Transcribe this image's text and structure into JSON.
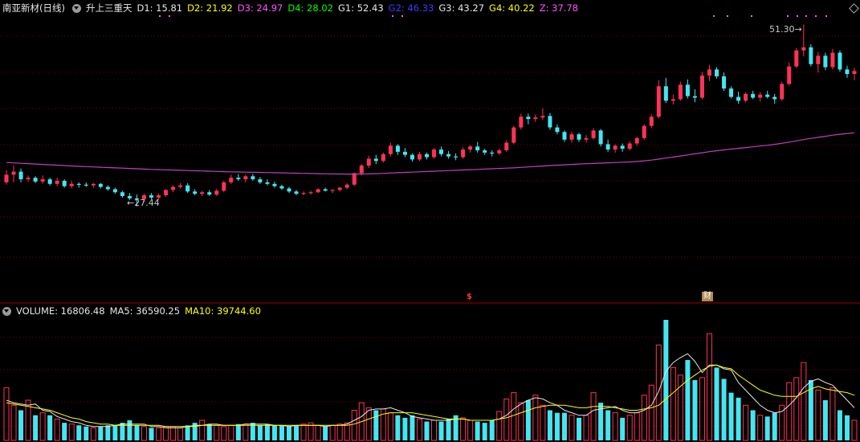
{
  "main_header": {
    "title": "南亚新材(日线)",
    "indicator": "升上三重天",
    "values": [
      {
        "label": "D1: 15.81",
        "color": "#e6e6e6"
      },
      {
        "label": "D2: 21.92",
        "color": "#ffff00"
      },
      {
        "label": "D3: 24.97",
        "color": "#ff55ff"
      },
      {
        "label": "D4: 28.02",
        "color": "#00ff00"
      },
      {
        "label": "G1: 52.43",
        "color": "#e6e6e6"
      },
      {
        "label": "G2: 46.33",
        "color": "#3b3bff"
      },
      {
        "label": "G3: 43.27",
        "color": "#e6e6e6"
      },
      {
        "label": "G4: 40.22",
        "color": "#ffff00"
      },
      {
        "label": "Z: 37.78",
        "color": "#ff55ff"
      }
    ]
  },
  "volume_header": {
    "values": [
      {
        "label": "VOLUME: 16806.48",
        "color": "#e6e6e6"
      },
      {
        "label": "MA5: 36590.25",
        "color": "#e6e6e6"
      },
      {
        "label": "MA10: 39744.60",
        "color": "#ffff00"
      }
    ]
  },
  "annotations": {
    "low_label": "27.44",
    "high_label": "51.30"
  },
  "markers": {
    "s": "$",
    "fin": "财"
  },
  "colors": {
    "up": "#ff3355",
    "down": "#44e6f0",
    "ma": "#c040c0",
    "grid": "#7a0000",
    "divider": "#a00000",
    "vol_up_border": "#ff3355",
    "vol_down": "#44e6f0"
  },
  "chart_data": [
    {
      "type": "candlestick",
      "title": "南亚新材(日线)",
      "annotations": {
        "low": 27.44,
        "high": 51.3
      },
      "ohlc": [
        [
          30.6,
          32.2,
          30.3,
          31.6
        ],
        [
          31.6,
          32.8,
          30.6,
          32.0
        ],
        [
          32.0,
          32.4,
          30.6,
          31.0
        ],
        [
          31.0,
          31.5,
          30.7,
          31.2
        ],
        [
          31.2,
          31.4,
          30.5,
          30.7
        ],
        [
          30.7,
          31.5,
          30.4,
          31.0
        ],
        [
          31.0,
          31.2,
          30.2,
          30.4
        ],
        [
          30.4,
          31.2,
          30.1,
          30.8
        ],
        [
          30.8,
          31.0,
          29.9,
          30.1
        ],
        [
          30.1,
          30.8,
          29.8,
          30.4
        ],
        [
          30.4,
          30.6,
          29.9,
          30.3
        ],
        [
          30.3,
          30.6,
          30.0,
          30.2
        ],
        [
          30.2,
          30.5,
          29.9,
          30.4
        ],
        [
          30.4,
          30.5,
          29.8,
          30.0
        ],
        [
          30.0,
          30.2,
          29.5,
          29.7
        ],
        [
          29.7,
          29.9,
          29.1,
          29.3
        ],
        [
          29.3,
          29.5,
          28.6,
          28.8
        ],
        [
          28.8,
          29.2,
          28.3,
          28.5
        ],
        [
          28.5,
          29.0,
          27.44,
          28.4
        ],
        [
          28.4,
          29.1,
          28.0,
          28.9
        ],
        [
          28.9,
          29.2,
          28.4,
          28.6
        ],
        [
          28.6,
          29.1,
          28.3,
          28.9
        ],
        [
          28.9,
          29.7,
          28.7,
          29.6
        ],
        [
          29.6,
          30.2,
          29.3,
          30.0
        ],
        [
          30.0,
          30.5,
          29.8,
          30.2
        ],
        [
          30.2,
          30.5,
          29.2,
          29.4
        ],
        [
          29.4,
          29.7,
          28.9,
          29.1
        ],
        [
          29.1,
          29.5,
          28.8,
          29.3
        ],
        [
          29.3,
          29.6,
          28.8,
          29.0
        ],
        [
          29.0,
          29.7,
          28.8,
          29.5
        ],
        [
          29.5,
          30.8,
          29.3,
          30.6
        ],
        [
          30.6,
          31.6,
          30.4,
          31.2
        ],
        [
          31.2,
          31.7,
          30.8,
          31.0
        ],
        [
          31.0,
          31.6,
          30.6,
          31.4
        ],
        [
          31.4,
          31.7,
          30.8,
          31.0
        ],
        [
          31.0,
          31.3,
          30.4,
          30.6
        ],
        [
          30.6,
          31.0,
          30.2,
          30.4
        ],
        [
          30.4,
          30.7,
          29.9,
          30.1
        ],
        [
          30.1,
          30.3,
          29.6,
          29.8
        ],
        [
          29.8,
          30.0,
          29.2,
          29.4
        ],
        [
          29.4,
          29.6,
          28.9,
          29.1
        ],
        [
          29.1,
          29.4,
          28.9,
          29.2
        ],
        [
          29.2,
          29.5,
          29.0,
          29.3
        ],
        [
          29.3,
          29.8,
          29.2,
          29.7
        ],
        [
          29.7,
          29.9,
          29.4,
          29.5
        ],
        [
          29.5,
          29.7,
          29.2,
          29.6
        ],
        [
          29.6,
          30.0,
          29.4,
          29.9
        ],
        [
          29.9,
          30.5,
          29.7,
          30.3
        ],
        [
          30.3,
          31.9,
          30.1,
          31.8
        ],
        [
          31.8,
          33.0,
          31.5,
          32.8
        ],
        [
          32.8,
          34.1,
          32.5,
          33.7
        ],
        [
          33.7,
          34.2,
          33.0,
          33.4
        ],
        [
          33.4,
          34.5,
          33.2,
          34.3
        ],
        [
          34.3,
          35.8,
          34.0,
          35.4
        ],
        [
          35.4,
          35.6,
          34.2,
          34.6
        ],
        [
          34.6,
          35.1,
          33.9,
          34.2
        ],
        [
          34.2,
          34.4,
          33.3,
          33.6
        ],
        [
          33.6,
          34.6,
          33.4,
          34.3
        ],
        [
          34.3,
          34.5,
          33.6,
          33.9
        ],
        [
          33.9,
          35.1,
          33.7,
          34.9
        ],
        [
          34.9,
          35.3,
          34.0,
          34.3
        ],
        [
          34.3,
          34.7,
          33.7,
          34.0
        ],
        [
          34.0,
          34.4,
          33.5,
          33.9
        ],
        [
          33.9,
          35.2,
          33.7,
          34.9
        ],
        [
          34.9,
          35.5,
          34.5,
          35.3
        ],
        [
          35.3,
          35.9,
          34.5,
          34.8
        ],
        [
          34.8,
          35.0,
          34.2,
          34.5
        ],
        [
          34.5,
          34.8,
          34.0,
          34.4
        ],
        [
          34.4,
          35.0,
          34.2,
          34.8
        ],
        [
          34.8,
          36.1,
          34.6,
          35.8
        ],
        [
          35.8,
          38.0,
          35.6,
          37.8
        ],
        [
          37.8,
          39.6,
          37.5,
          39.2
        ],
        [
          39.2,
          39.6,
          38.2,
          38.9
        ],
        [
          38.9,
          39.5,
          38.5,
          39.1
        ],
        [
          39.1,
          40.3,
          38.8,
          39.3
        ],
        [
          39.3,
          39.7,
          37.5,
          37.8
        ],
        [
          37.8,
          38.2,
          36.9,
          37.2
        ],
        [
          37.2,
          37.4,
          35.9,
          36.2
        ],
        [
          36.2,
          37.2,
          35.8,
          36.9
        ],
        [
          36.9,
          37.1,
          35.9,
          36.2
        ],
        [
          36.2,
          36.8,
          35.8,
          36.4
        ],
        [
          36.4,
          37.7,
          36.2,
          37.4
        ],
        [
          37.4,
          37.6,
          35.3,
          35.6
        ],
        [
          35.6,
          36.2,
          34.6,
          34.9
        ],
        [
          34.9,
          35.6,
          34.5,
          35.4
        ],
        [
          35.4,
          35.7,
          34.6,
          35.0
        ],
        [
          35.0,
          36.0,
          34.8,
          35.7
        ],
        [
          35.7,
          36.6,
          35.4,
          36.4
        ],
        [
          36.4,
          38.2,
          36.2,
          38.0
        ],
        [
          38.0,
          39.5,
          37.7,
          39.2
        ],
        [
          39.2,
          44.0,
          39.0,
          43.2
        ],
        [
          43.2,
          44.3,
          41.0,
          41.3
        ],
        [
          41.3,
          42.1,
          40.8,
          41.5
        ],
        [
          41.5,
          43.8,
          41.3,
          43.4
        ],
        [
          43.4,
          44.1,
          41.6,
          41.9
        ],
        [
          41.9,
          42.8,
          41.1,
          41.7
        ],
        [
          41.7,
          45.1,
          41.5,
          44.6
        ],
        [
          44.6,
          46.0,
          43.9,
          45.4
        ],
        [
          45.4,
          45.7,
          44.2,
          44.5
        ],
        [
          44.5,
          45.0,
          42.6,
          42.9
        ],
        [
          42.9,
          43.2,
          41.6,
          41.8
        ],
        [
          41.8,
          42.5,
          40.9,
          41.3
        ],
        [
          41.3,
          42.4,
          41.1,
          42.2
        ],
        [
          42.2,
          42.6,
          41.5,
          41.7
        ],
        [
          41.7,
          42.4,
          41.2,
          42.1
        ],
        [
          42.1,
          42.6,
          41.6,
          41.8
        ],
        [
          41.8,
          42.2,
          40.9,
          41.5
        ],
        [
          41.5,
          43.8,
          41.3,
          43.5
        ],
        [
          43.5,
          46.3,
          43.3,
          45.8
        ],
        [
          45.8,
          48.2,
          45.6,
          47.9
        ],
        [
          47.9,
          51.3,
          47.1,
          48.3
        ],
        [
          48.3,
          48.7,
          45.8,
          46.1
        ],
        [
          46.1,
          47.7,
          45.0,
          47.2
        ],
        [
          47.2,
          47.6,
          45.3,
          45.7
        ],
        [
          45.7,
          48.1,
          45.4,
          47.6
        ],
        [
          47.6,
          47.9,
          45.1,
          45.4
        ],
        [
          45.4,
          45.9,
          44.3,
          44.8
        ],
        [
          44.8,
          45.6,
          44.0,
          45.2
        ]
      ],
      "ma": [
        33.2,
        33.15,
        33.1,
        33.05,
        33.0,
        32.95,
        32.9,
        32.85,
        32.8,
        32.75,
        32.7,
        32.66,
        32.62,
        32.58,
        32.54,
        32.5,
        32.46,
        32.42,
        32.38,
        32.34,
        32.3,
        32.27,
        32.24,
        32.21,
        32.18,
        32.15,
        32.12,
        32.09,
        32.06,
        32.03,
        32.0,
        31.98,
        31.96,
        31.94,
        31.92,
        31.9,
        31.88,
        31.86,
        31.84,
        31.82,
        31.8,
        31.78,
        31.76,
        31.74,
        31.72,
        31.7,
        31.69,
        31.68,
        31.68,
        31.69,
        31.71,
        31.74,
        31.78,
        31.82,
        31.86,
        31.9,
        31.94,
        31.98,
        32.02,
        32.06,
        32.1,
        32.14,
        32.18,
        32.22,
        32.26,
        32.3,
        32.34,
        32.38,
        32.42,
        32.46,
        32.5,
        32.56,
        32.62,
        32.68,
        32.74,
        32.8,
        32.85,
        32.9,
        32.95,
        33.0,
        33.04,
        33.08,
        33.12,
        33.16,
        33.2,
        33.24,
        33.28,
        33.34,
        33.42,
        33.52,
        33.64,
        33.78,
        33.92,
        34.06,
        34.2,
        34.34,
        34.48,
        34.62,
        34.74,
        34.86,
        34.96,
        35.06,
        35.16,
        35.26,
        35.36,
        35.46,
        35.58,
        35.72,
        35.88,
        36.04,
        36.2,
        36.36,
        36.5,
        36.64,
        36.78,
        36.9,
        37.0,
        37.1
      ]
    },
    {
      "type": "bar",
      "title": "VOLUME",
      "series_names": [
        "VOLUME",
        "MA5",
        "MA10"
      ],
      "values": [
        42,
        28,
        24,
        32,
        20,
        22,
        20,
        17,
        14,
        13,
        12,
        11,
        10,
        11,
        12,
        12,
        14,
        16,
        12,
        11,
        10,
        10,
        11,
        11,
        10,
        12,
        14,
        16,
        13,
        12,
        11,
        12,
        13,
        13,
        14,
        12,
        13,
        12,
        12,
        11,
        12,
        13,
        14,
        12,
        11,
        12,
        13,
        14,
        24,
        30,
        26,
        24,
        25,
        22,
        20,
        18,
        20,
        17,
        15,
        16,
        15,
        17,
        20,
        18,
        16,
        15,
        14,
        16,
        23,
        33,
        38,
        30,
        32,
        36,
        28,
        24,
        22,
        22,
        20,
        18,
        20,
        38,
        30,
        24,
        22,
        18,
        20,
        22,
        36,
        44,
        76,
        96,
        58,
        52,
        64,
        48,
        50,
        85,
        58,
        49,
        38,
        34,
        28,
        24,
        20,
        19,
        22,
        28,
        46,
        50,
        62,
        48,
        40,
        32,
        42,
        24,
        20,
        16
      ],
      "up_flags": [
        1,
        1,
        0,
        1,
        0,
        1,
        0,
        1,
        0,
        1,
        0,
        0,
        1,
        0,
        0,
        0,
        0,
        0,
        0,
        1,
        0,
        1,
        1,
        1,
        1,
        0,
        0,
        1,
        0,
        1,
        1,
        1,
        0,
        1,
        0,
        0,
        0,
        0,
        0,
        0,
        0,
        1,
        1,
        1,
        0,
        1,
        1,
        1,
        1,
        1,
        1,
        0,
        1,
        1,
        0,
        0,
        0,
        1,
        0,
        1,
        0,
        0,
        0,
        1,
        1,
        0,
        0,
        0,
        1,
        1,
        1,
        1,
        0,
        1,
        1,
        0,
        0,
        0,
        1,
        0,
        1,
        1,
        0,
        0,
        1,
        0,
        1,
        1,
        1,
        1,
        1,
        0,
        1,
        1,
        0,
        0,
        1,
        1,
        0,
        0,
        0,
        0,
        1,
        0,
        1,
        0,
        0,
        1,
        1,
        1,
        1,
        0,
        1,
        0,
        1,
        0,
        0,
        1
      ],
      "ma5": [
        32,
        30,
        29,
        28,
        29,
        24,
        23,
        19,
        17,
        15,
        14,
        12,
        11,
        11,
        11,
        12,
        13,
        13,
        13,
        13,
        11,
        11,
        10,
        10,
        10,
        11,
        12,
        12,
        13,
        13,
        12,
        12,
        12,
        13,
        13,
        13,
        13,
        12,
        12,
        11,
        12,
        12,
        12,
        12,
        11,
        12,
        12,
        13,
        16,
        19,
        24,
        25,
        25,
        26,
        24,
        22,
        19,
        18,
        17,
        16,
        16,
        16,
        17,
        17,
        16,
        16,
        16,
        16,
        17,
        20,
        25,
        29,
        32,
        34,
        33,
        30,
        28,
        24,
        22,
        20,
        20,
        24,
        25,
        26,
        27,
        24,
        22,
        22,
        24,
        28,
        39,
        55,
        62,
        66,
        69,
        63,
        54,
        60,
        60,
        57,
        56,
        46,
        40,
        34,
        28,
        24,
        22,
        23,
        28,
        34,
        42,
        47,
        49,
        46,
        44,
        38,
        32,
        26
      ],
      "ma10": [
        30,
        29,
        28,
        27,
        26,
        25,
        24,
        22,
        20,
        18,
        17,
        15,
        14,
        13,
        13,
        12,
        12,
        12,
        12,
        12,
        12,
        12,
        11,
        11,
        11,
        11,
        11,
        12,
        12,
        12,
        12,
        12,
        12,
        12,
        12,
        12,
        12,
        12,
        12,
        12,
        12,
        12,
        12,
        12,
        12,
        12,
        12,
        12,
        13,
        15,
        17,
        19,
        21,
        22,
        22,
        22,
        22,
        21,
        20,
        19,
        18,
        17,
        17,
        17,
        16,
        16,
        16,
        16,
        17,
        18,
        20,
        22,
        24,
        26,
        27,
        28,
        28,
        28,
        27,
        26,
        26,
        27,
        27,
        27,
        26,
        25,
        24,
        24,
        25,
        26,
        28,
        33,
        38,
        43,
        48,
        52,
        56,
        59,
        60,
        58,
        57,
        52,
        48,
        44,
        40,
        38,
        36,
        35,
        35,
        35,
        38,
        41,
        43,
        41,
        40,
        39,
        38,
        36
      ]
    }
  ]
}
